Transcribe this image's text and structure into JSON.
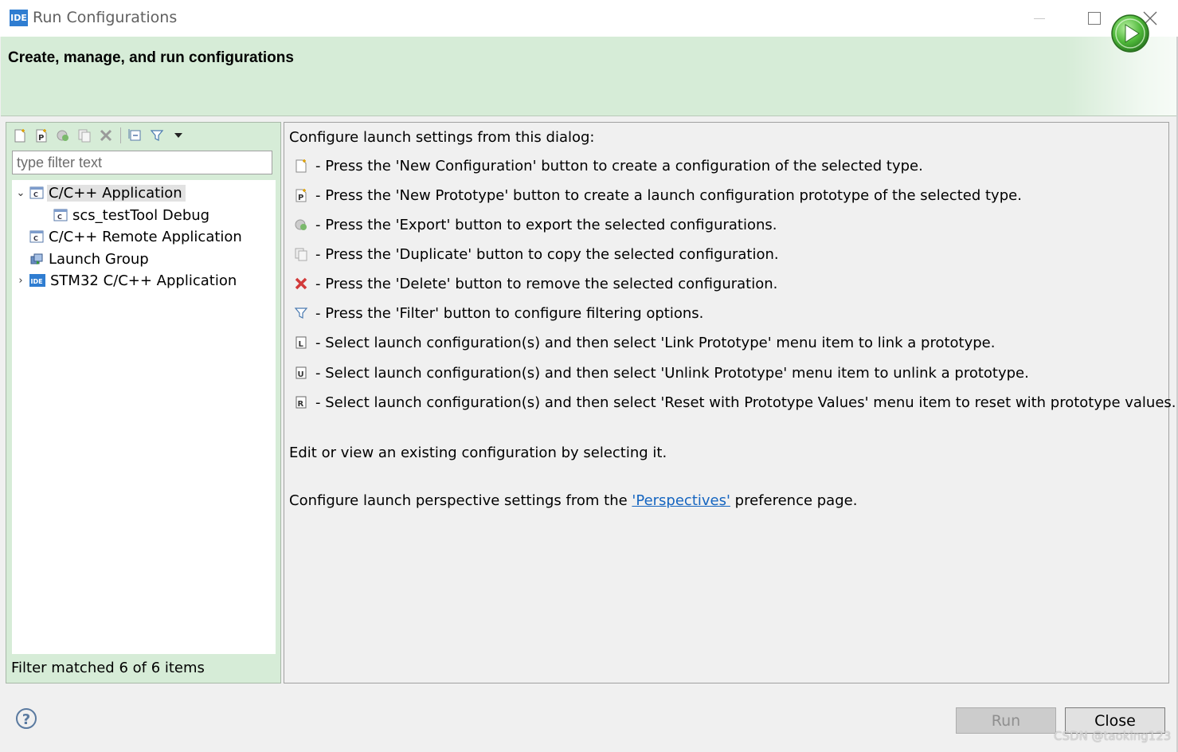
{
  "window": {
    "title": "Run Configurations",
    "app_icon_text": "IDE"
  },
  "banner": {
    "title": "Create, manage, and run configurations"
  },
  "left": {
    "filter_placeholder": "type filter text",
    "tree": [
      {
        "label": "C/C++ Application",
        "expanded": true,
        "selected": true,
        "icon": "c-config-icon"
      },
      {
        "label": "scs_testTool Debug",
        "icon": "c-config-icon"
      },
      {
        "label": "C/C++ Remote Application",
        "icon": "c-config-icon"
      },
      {
        "label": "Launch Group",
        "icon": "launch-group-icon"
      },
      {
        "label": "STM32 C/C++ Application",
        "expanded": false,
        "icon": "ide-icon"
      }
    ],
    "status": "Filter matched 6 of 6 items"
  },
  "right": {
    "intro": "Configure launch settings from this dialog:",
    "items": [
      {
        "icon": "new-config-icon",
        "text": "- Press the 'New Configuration' button to create a configuration of the selected type."
      },
      {
        "icon": "new-prototype-icon",
        "text": "- Press the 'New Prototype' button to create a launch configuration prototype of the selected type."
      },
      {
        "icon": "export-icon",
        "text": "- Press the 'Export' button to export the selected configurations."
      },
      {
        "icon": "duplicate-icon",
        "text": "- Press the 'Duplicate' button to copy the selected configuration."
      },
      {
        "icon": "delete-icon",
        "text": "- Press the 'Delete' button to remove the selected configuration."
      },
      {
        "icon": "filter-icon",
        "text": "- Press the 'Filter' button to configure filtering options."
      },
      {
        "icon": "link-prototype-icon",
        "text": "- Select launch configuration(s) and then select 'Link Prototype' menu item to link a prototype."
      },
      {
        "icon": "unlink-prototype-icon",
        "text": "- Select launch configuration(s) and then select 'Unlink Prototype' menu item to unlink a prototype."
      },
      {
        "icon": "reset-prototype-icon",
        "text": "- Select launch configuration(s) and then select 'Reset with Prototype Values' menu item to reset with prototype values."
      }
    ],
    "edit_text": "Edit or view an existing configuration by selecting it.",
    "perspective_prefix": "Configure launch perspective settings from the ",
    "perspective_link": "'Perspectives'",
    "perspective_suffix": " preference page."
  },
  "buttons": {
    "help": "?",
    "run": "Run",
    "close": "Close"
  },
  "watermark": "CSDN @taoking123"
}
